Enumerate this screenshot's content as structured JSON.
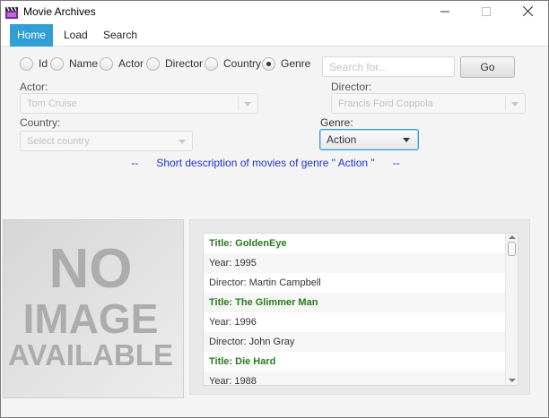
{
  "window": {
    "title": "Movie Archives",
    "app_icon": "clapperboard-icon",
    "controls": [
      "minimize-icon",
      "maximize-icon",
      "close-icon"
    ]
  },
  "menu": {
    "items": [
      {
        "label": "Home",
        "active": true
      },
      {
        "label": "Load",
        "active": false
      },
      {
        "label": "Search",
        "active": false
      }
    ]
  },
  "search_options": [
    {
      "label": "Id",
      "checked": false
    },
    {
      "label": "Name",
      "checked": false
    },
    {
      "label": "Actor",
      "checked": false
    },
    {
      "label": "Director",
      "checked": false
    },
    {
      "label": "Country",
      "checked": false
    },
    {
      "label": "Genre",
      "checked": true
    }
  ],
  "search": {
    "placeholder": "Search for...",
    "value": "",
    "button_label": "Go"
  },
  "filters": {
    "actor": {
      "label": "Actor:",
      "value": "Tom Cruise"
    },
    "director": {
      "label": "Director:",
      "value": "Francis Ford Coppola"
    },
    "country": {
      "label": "Country:",
      "placeholder": "Select country"
    },
    "genre": {
      "label": "Genre:",
      "value": "Action"
    }
  },
  "description": "--      Short description of movies of genre \" Action \"      --",
  "image_placeholder": {
    "lines": [
      "NO",
      "IMAGE",
      "AVAILABLE"
    ]
  },
  "movie_list": [
    {
      "text": "Title: GoldenEye",
      "kind": "title"
    },
    {
      "text": "Year: 1995",
      "kind": "info"
    },
    {
      "text": "Director: Martin Campbell",
      "kind": "info"
    },
    {
      "text": "Title: The Glimmer Man",
      "kind": "title"
    },
    {
      "text": "Year: 1996",
      "kind": "info"
    },
    {
      "text": "Director: John Gray",
      "kind": "info"
    },
    {
      "text": "Title: Die Hard",
      "kind": "title"
    },
    {
      "text": "Year: 1988",
      "kind": "info"
    }
  ],
  "colors": {
    "accent": "#2f9fd4",
    "title_green": "#2a7a1f",
    "description_blue": "#1f35d9"
  }
}
